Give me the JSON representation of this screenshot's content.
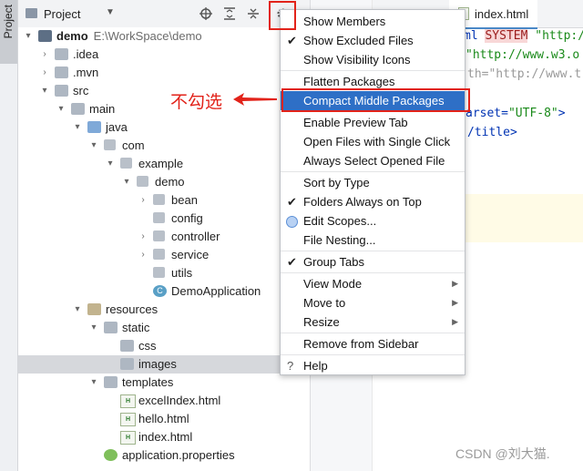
{
  "tool_strip": {
    "tab_label": "Project"
  },
  "project_panel": {
    "title": "Project",
    "dropdown": "▼"
  },
  "tree": [
    {
      "depth": 0,
      "arrow": "▾",
      "icon": "module",
      "label": "demo",
      "sub": "E:\\WorkSpace\\demo",
      "bold": true
    },
    {
      "depth": 1,
      "arrow": "›",
      "icon": "folder",
      "label": ".idea"
    },
    {
      "depth": 1,
      "arrow": "›",
      "icon": "folder",
      "label": ".mvn"
    },
    {
      "depth": 1,
      "arrow": "▾",
      "icon": "folder",
      "label": "src"
    },
    {
      "depth": 2,
      "arrow": "▾",
      "icon": "folder",
      "label": "main"
    },
    {
      "depth": 3,
      "arrow": "▾",
      "icon": "folder-blue",
      "label": "java"
    },
    {
      "depth": 4,
      "arrow": "▾",
      "icon": "package",
      "label": "com"
    },
    {
      "depth": 5,
      "arrow": "▾",
      "icon": "package",
      "label": "example"
    },
    {
      "depth": 6,
      "arrow": "▾",
      "icon": "package",
      "label": "demo"
    },
    {
      "depth": 7,
      "arrow": "›",
      "icon": "package",
      "label": "bean"
    },
    {
      "depth": 7,
      "arrow": "",
      "icon": "package",
      "label": "config"
    },
    {
      "depth": 7,
      "arrow": "›",
      "icon": "package",
      "label": "controller"
    },
    {
      "depth": 7,
      "arrow": "›",
      "icon": "package",
      "label": "service"
    },
    {
      "depth": 7,
      "arrow": "",
      "icon": "package",
      "label": "utils"
    },
    {
      "depth": 7,
      "arrow": "",
      "icon": "class",
      "label": "DemoApplication"
    },
    {
      "depth": 3,
      "arrow": "▾",
      "icon": "folder-res",
      "label": "resources"
    },
    {
      "depth": 4,
      "arrow": "▾",
      "icon": "folder",
      "label": "static"
    },
    {
      "depth": 5,
      "arrow": "",
      "icon": "folder",
      "label": "css"
    },
    {
      "depth": 5,
      "arrow": "",
      "icon": "folder",
      "label": "images",
      "selected": true
    },
    {
      "depth": 4,
      "arrow": "▾",
      "icon": "folder",
      "label": "templates"
    },
    {
      "depth": 5,
      "arrow": "",
      "icon": "html",
      "label": "excelIndex.html"
    },
    {
      "depth": 5,
      "arrow": "",
      "icon": "html",
      "label": "hello.html"
    },
    {
      "depth": 5,
      "arrow": "",
      "icon": "html",
      "label": "index.html"
    },
    {
      "depth": 4,
      "arrow": "",
      "icon": "properties",
      "label": "application.properties"
    }
  ],
  "menu": [
    {
      "label": "Show Members"
    },
    {
      "label": "Show Excluded Files",
      "checked": true
    },
    {
      "label": "Show Visibility Icons"
    },
    {
      "sep": true
    },
    {
      "label": "Flatten Packages"
    },
    {
      "label": "Compact Middle Packages",
      "active": true
    },
    {
      "sep": true
    },
    {
      "label": "Enable Preview Tab"
    },
    {
      "label": "Open Files with Single Click"
    },
    {
      "label": "Always Select Opened File"
    },
    {
      "sep": true
    },
    {
      "label": "Sort by Type"
    },
    {
      "label": "Folders Always on Top",
      "checked": true
    },
    {
      "label": "Edit Scopes...",
      "radio": true
    },
    {
      "label": "File Nesting..."
    },
    {
      "sep": true
    },
    {
      "label": "Group Tabs",
      "checked": true
    },
    {
      "sep": true
    },
    {
      "label": "View Mode",
      "submenu": true
    },
    {
      "label": "Move to",
      "submenu": true
    },
    {
      "label": "Resize",
      "submenu": true
    },
    {
      "sep": true
    },
    {
      "label": "Remove from Sidebar"
    },
    {
      "sep": true
    },
    {
      "label": "Help",
      "help": true
    }
  ],
  "editor": {
    "tab_label": "index.html",
    "lines": [
      "ml SYSTEM \"http://",
      "\"http://www.w3.o",
      "th=\"http://www.t",
      "",
      "arset=\"UTF-8\">",
      "/title>"
    ]
  },
  "annotation": {
    "note": "不勾选"
  },
  "watermark": "CSDN @刘大猫."
}
